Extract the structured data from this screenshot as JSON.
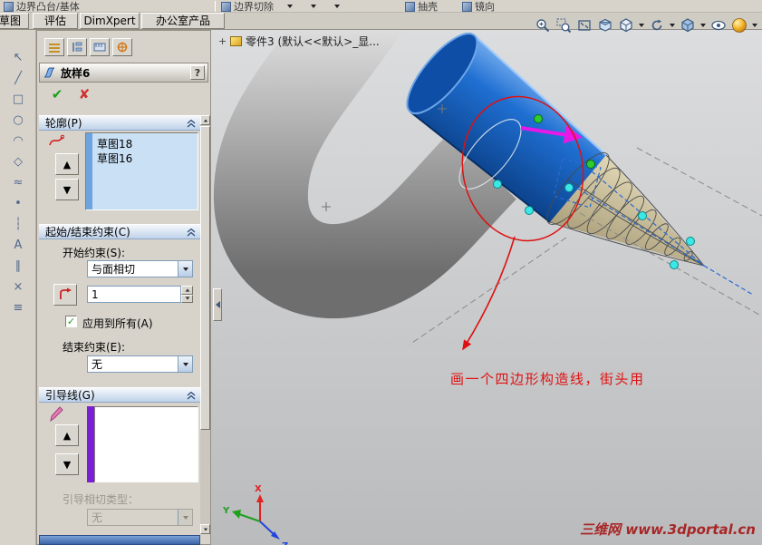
{
  "toolbar_top": {
    "items": [
      {
        "name": "boundary-boss-base",
        "label": "边界凸台/基体"
      },
      {
        "name": "boundary-cut",
        "label": "边界切除"
      },
      {
        "name": "shell",
        "label": "抽壳"
      },
      {
        "name": "mirror",
        "label": "镜向"
      }
    ]
  },
  "ribbon_tabs": [
    {
      "label": "草图"
    },
    {
      "label": "评估"
    },
    {
      "label": "DimXpert"
    },
    {
      "label": "办公室产品"
    }
  ],
  "view_toolbar_icons": [
    "zoom-in",
    "zoom-window",
    "zoom-fit",
    "section-view",
    "view-orientation",
    "rotate-view",
    "display-style",
    "hide-show-items",
    "appearance"
  ],
  "left_toolbar_icons": [
    {
      "name": "select",
      "glyph": "↖"
    },
    {
      "name": "line",
      "glyph": "╱"
    },
    {
      "name": "rectangle",
      "glyph": "□"
    },
    {
      "name": "circle",
      "glyph": "○"
    },
    {
      "name": "arc",
      "glyph": "◠"
    },
    {
      "name": "polygon",
      "glyph": "◇"
    },
    {
      "name": "spline",
      "glyph": "≈"
    },
    {
      "name": "point",
      "glyph": "•"
    },
    {
      "name": "centerline",
      "glyph": "┆"
    },
    {
      "name": "text",
      "glyph": "A"
    },
    {
      "name": "mirror-entities",
      "glyph": "∥"
    },
    {
      "name": "trim",
      "glyph": "×"
    },
    {
      "name": "offset",
      "glyph": "≡"
    }
  ],
  "property_manager": {
    "title": "放样6",
    "help_glyph": "?",
    "ok_glyph": "✔",
    "cancel_glyph": "✘",
    "profiles": {
      "header": "轮廓(P)",
      "items": [
        "草图18",
        "草图16"
      ]
    },
    "constraints": {
      "header": "起始/结束约束(C)",
      "start_label": "开始约束(S):",
      "start_value": "与面相切",
      "length_value": "1",
      "apply_all_label": "应用到所有(A)",
      "apply_all_checked": true,
      "end_label": "结束约束(E):",
      "end_value": "无"
    },
    "guides": {
      "header": "引导线(G)",
      "tangency_label": "引导相切类型：",
      "tangency_value": "无"
    }
  },
  "viewport": {
    "document_label": "零件3 (默认<<默认>_显...",
    "annotation_text": "画一个四边形构造线，街头用",
    "watermark_text": "三维网 www.3dportal.cn",
    "triad": {
      "x_label": "X",
      "y_label": "Y",
      "z_label": "Z"
    }
  },
  "glyphs": {
    "check": "✓",
    "plus": "+",
    "up": "▲",
    "down": "▼"
  },
  "colors": {
    "selection_blue": "#1667cc",
    "annotation_red": "#dd1111",
    "guide_purple": "#7b1fd6",
    "profile_list_bg": "#c9e0f5"
  }
}
